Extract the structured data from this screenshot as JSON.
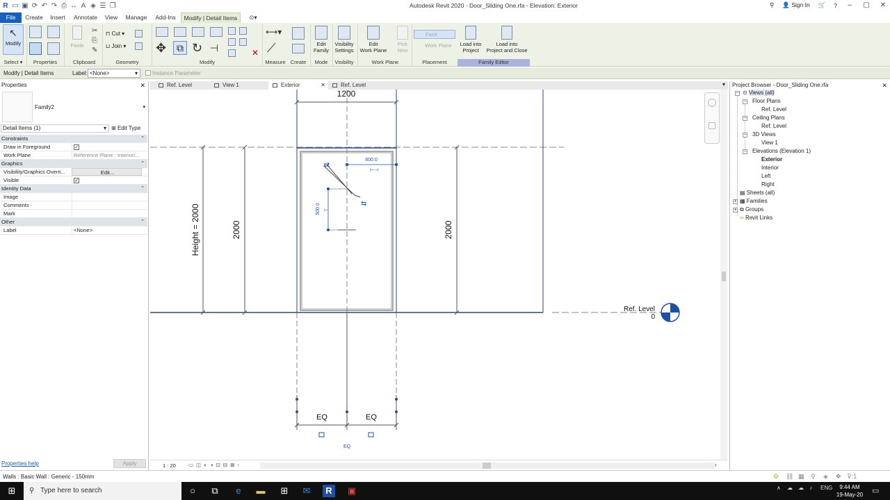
{
  "window": {
    "title": "Autodesk Revit 2020 - Door_Sliding One.rfa - Elevation: Exterior",
    "sign_in": "Sign In"
  },
  "tabs": [
    "File",
    "Create",
    "Insert",
    "Annotate",
    "View",
    "Manage",
    "Add-Ins",
    "Modify | Detail Items"
  ],
  "ribbon": {
    "modify": "Modify",
    "select": "Select",
    "paste": "Paste",
    "cut": "Cut",
    "join": "Join",
    "panels": {
      "properties": "Properties",
      "clipboard": "Clipboard",
      "geometry": "Geometry",
      "modify": "Modify",
      "measure": "Measure",
      "create": "Create",
      "mode": "Mode",
      "visibility": "Visibility",
      "work_plane": "Work Plane",
      "placement": "Placement",
      "family_editor": "Family Editor"
    },
    "buttons": {
      "edit_family_1": "Edit",
      "edit_family_2": "Family",
      "vis_settings_1": "Visibility",
      "vis_settings_2": "Settings",
      "edit_wp_1": "Edit",
      "edit_wp_2": "Work Plane",
      "pick_new_1": "Pick",
      "pick_new_2": "New",
      "face": "Face",
      "work_plane": "Work Plane",
      "load_proj_1": "Load into",
      "load_proj_2": "Project",
      "load_close_1": "Load into",
      "load_close_2": "Project and Close"
    }
  },
  "options_bar": {
    "context": "Modify | Detail Items",
    "label_caption": "Label:",
    "label_value": "<None>",
    "instance_param": "Instance Parameter"
  },
  "properties": {
    "title": "Properties",
    "type_name": "Family2",
    "selector": "Detail Items (1)",
    "edit_type": "Edit Type",
    "rows": [
      {
        "k": "Constraints",
        "group": true
      },
      {
        "k": "Draw in Foreground",
        "v": "",
        "check": true
      },
      {
        "k": "Work Plane",
        "v": "Reference Plane : Interior/...",
        "grey": true
      },
      {
        "k": "Graphics",
        "group": true
      },
      {
        "k": "Visibility/Graphics Overri...",
        "v": "Edit...",
        "button": true
      },
      {
        "k": "Visible",
        "v": "",
        "check": true
      },
      {
        "k": "Identity Data",
        "group": true
      },
      {
        "k": "Image",
        "v": ""
      },
      {
        "k": "Comments",
        "v": ""
      },
      {
        "k": "Mark",
        "v": ""
      },
      {
        "k": "Other",
        "group": true
      },
      {
        "k": "Label",
        "v": "<None>"
      }
    ],
    "help": "Properties help",
    "apply": "Apply"
  },
  "view_tabs": [
    {
      "label": "Ref. Level",
      "active": false
    },
    {
      "label": "View 1",
      "active": false
    },
    {
      "label": "Exterior",
      "active": true
    },
    {
      "label": "Ref. Level",
      "active": false
    }
  ],
  "canvas": {
    "top_dim": "1200",
    "height_dim": "Height = 2000",
    "left_dim": "2000",
    "right_dim": "2000",
    "width_600": "600.0",
    "height_500": "500.0",
    "eq_left": "EQ",
    "eq_right": "EQ",
    "eq_bottom": "EQ",
    "level_name": "Ref. Level",
    "level_value": "0"
  },
  "view_control": {
    "scale": "1 : 20"
  },
  "browser": {
    "title": "Project Browser - Door_Sliding One.rfa",
    "nodes": {
      "views_all": "Views (all)",
      "floor_plans": "Floor Plans",
      "fp_ref_level": "Ref. Level",
      "ceiling_plans": "Ceiling Plans",
      "cp_ref_level": "Ref. Level",
      "views_3d": "3D Views",
      "view_1": "View 1",
      "elevations": "Elevations (Elevation 1)",
      "exterior": "Exterior",
      "interior": "Interior",
      "left": "Left",
      "right": "Right",
      "sheets": "Sheets (all)",
      "families": "Families",
      "groups": "Groups",
      "revit_links": "Revit Links"
    }
  },
  "status": {
    "text": "Walls : Basic Wall : Generic - 150mm"
  },
  "taskbar": {
    "search": "Type here to search",
    "lang": "ENG",
    "time": "9:44 AM",
    "date": "19-May-20"
  },
  "colors": {
    "accent": "#1560bd",
    "ribbon_bg": "#eef1e6",
    "family_editor": "#a9b3dc",
    "selection": "#1f4fa8"
  }
}
